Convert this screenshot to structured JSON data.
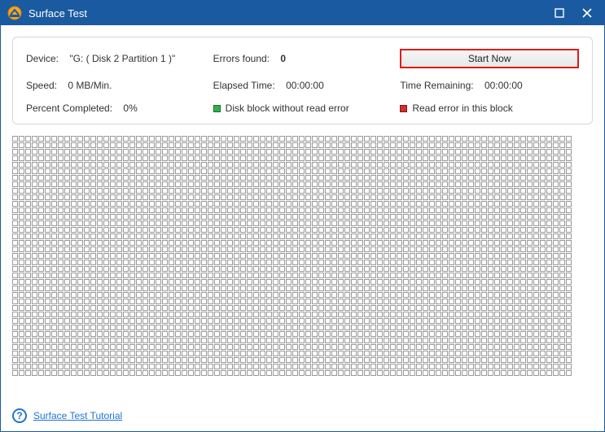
{
  "window": {
    "title": "Surface Test"
  },
  "panel": {
    "device_label": "Device:",
    "device_value": "\"G: ( Disk 2 Partition 1 )\"",
    "errors_label": "Errors found:",
    "errors_value": "0",
    "start_button": "Start Now",
    "speed_label": "Speed:",
    "speed_value": "0 MB/Min.",
    "elapsed_label": "Elapsed Time:",
    "elapsed_value": "00:00:00",
    "remaining_label": "Time Remaining:",
    "remaining_value": "00:00:00",
    "percent_label": "Percent Completed:",
    "percent_value": "0%",
    "legend_ok": "Disk block without read error",
    "legend_err": "Read error in this block"
  },
  "grid": {
    "cols": 86,
    "rows": 37
  },
  "footer": {
    "tutorial_link": "Surface Test Tutorial"
  },
  "colors": {
    "titlebar": "#1a5aa0",
    "ok_block": "#2fb24c",
    "err_block": "#d22d2d",
    "highlight_border": "#e01b1b",
    "link": "#1e74d2"
  }
}
